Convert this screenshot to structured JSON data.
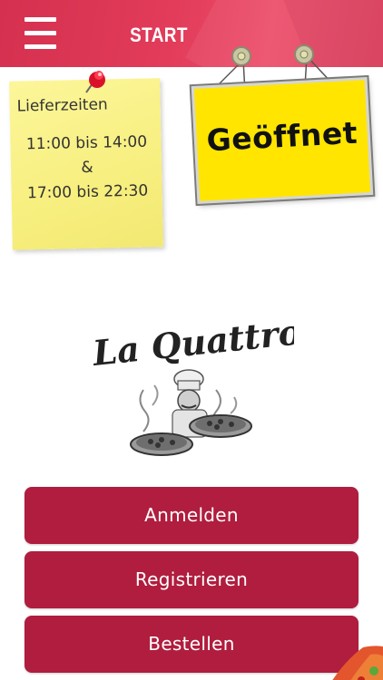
{
  "header": {
    "title": "START",
    "menu_icon": "hamburger-menu-icon",
    "colors": {
      "bar": "#e03a58",
      "text": "#ffffff"
    }
  },
  "sticky_note": {
    "title": "Lieferzeiten",
    "lines": [
      "11:00 bis 14:00",
      "&",
      "17:00 bis 22:30"
    ],
    "pin_icon": "pushpin-icon",
    "color": "#f7ef7f"
  },
  "status_sign": {
    "text": "Geöffnet",
    "color": "#ffe500"
  },
  "logo": {
    "text": "La Quattro",
    "image": "chef-with-pizzas-illustration"
  },
  "buttons": {
    "login": "Anmelden",
    "register": "Registrieren",
    "order": "Bestellen",
    "color": "#b01d3e"
  }
}
